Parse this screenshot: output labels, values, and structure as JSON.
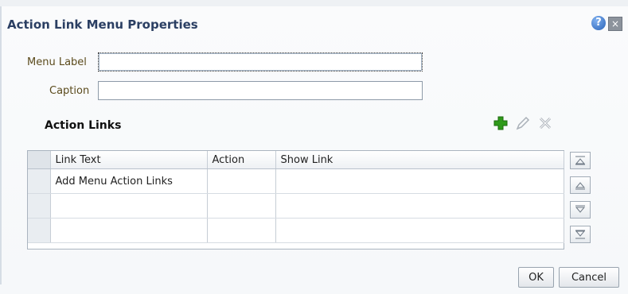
{
  "dialog": {
    "title": "Action Link Menu Properties",
    "help_icon": "?",
    "close_icon": "×"
  },
  "fields": {
    "menu_label": {
      "label": "Menu Label",
      "value": ""
    },
    "caption": {
      "label": "Caption",
      "value": ""
    }
  },
  "action_links": {
    "title": "Action Links",
    "toolbar": {
      "add_icon": "plus-icon",
      "edit_icon": "pencil-icon",
      "delete_icon": "x-icon"
    },
    "columns": [
      "Link Text",
      "Action",
      "Show Link"
    ],
    "rows": [
      [
        "Add Menu Action Links",
        "",
        ""
      ],
      [
        "",
        "",
        ""
      ],
      [
        "",
        "",
        ""
      ]
    ],
    "move_buttons": [
      "move-top-icon",
      "move-up-icon",
      "move-down-icon",
      "move-bottom-icon"
    ]
  },
  "buttons": {
    "ok": "OK",
    "cancel": "Cancel"
  },
  "colors": {
    "title": "#2b3f63",
    "label": "#5b4a1c",
    "add_green": "#2f9a1a"
  }
}
